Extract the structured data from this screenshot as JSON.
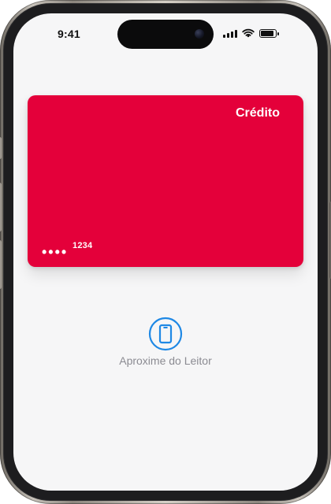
{
  "status_bar": {
    "time": "9:41",
    "icons": [
      "signal-icon",
      "wifi-icon",
      "battery-icon"
    ]
  },
  "card": {
    "type_label": "Crédito",
    "masked_dots": "••••",
    "last4": "1234",
    "color": "#e4003a"
  },
  "reader": {
    "label": "Aproxime do Leitor",
    "icon": "tap-to-pay-icon",
    "accent": "#1e88e5"
  }
}
